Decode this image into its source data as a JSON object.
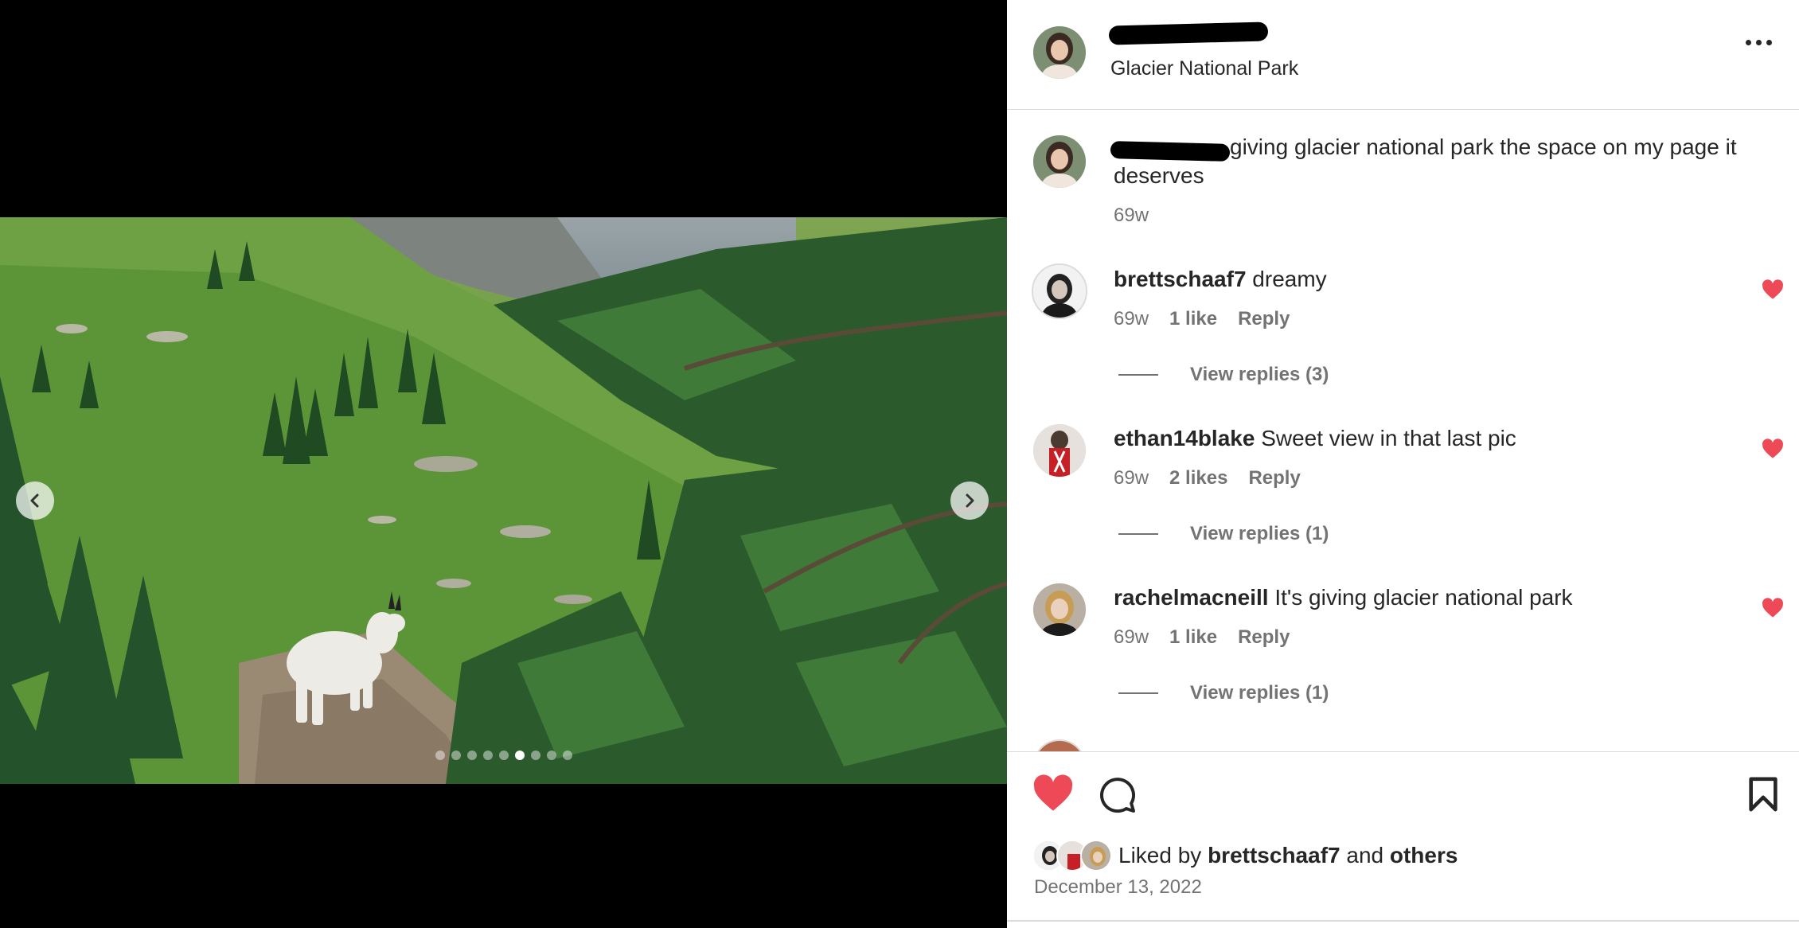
{
  "post": {
    "location": "Glacier National Park",
    "caption": {
      "text": "giving glacier national park the space on my page it deserves",
      "time": "69w"
    }
  },
  "comments": [
    {
      "username": "brettschaaf7",
      "text": "dreamy",
      "time": "69w",
      "likes": "1 like",
      "reply_label": "Reply",
      "view_replies": "View replies (3)"
    },
    {
      "username": "ethan14blake",
      "text": "Sweet view in that last pic",
      "time": "69w",
      "likes": "2 likes",
      "reply_label": "Reply",
      "view_replies": "View replies (1)"
    },
    {
      "username": "rachelmacneill",
      "text": "It's giving glacier national park",
      "time": "69w",
      "likes": "1 like",
      "reply_label": "Reply",
      "view_replies": "View replies (1)"
    }
  ],
  "footer": {
    "liked_by_prefix": "Liked by",
    "liked_by_user": "brettschaaf7",
    "liked_by_and": "and",
    "liked_by_others": "others",
    "date": "December 13, 2022"
  },
  "carousel": {
    "slide_count": 9,
    "active_slide": 6
  },
  "colors": {
    "like_red": "#ed4956",
    "text_primary": "#262626",
    "text_secondary": "#737373",
    "divider": "#dbdbdb"
  },
  "icons": [
    "chevron-left-icon",
    "chevron-right-icon",
    "more-icon",
    "heart-icon",
    "comment-icon",
    "bookmark-icon"
  ]
}
